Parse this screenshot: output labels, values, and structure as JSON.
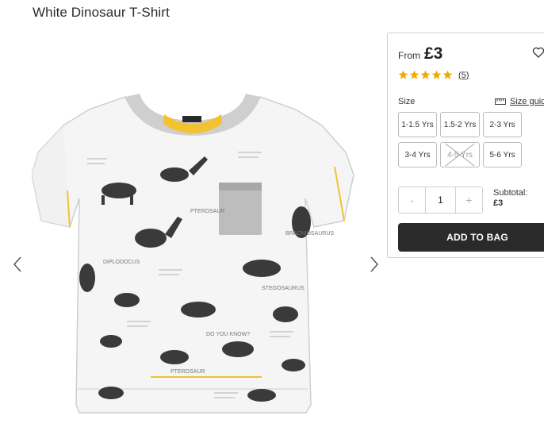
{
  "product": {
    "title": "White Dinosaur T-Shirt"
  },
  "gallery": {
    "prev_icon": "chevron-left-icon",
    "next_icon": "chevron-right-icon",
    "shirt_texts": [
      "PTEROSAUR",
      "DIPLODOCUS",
      "STEGOSAURUS",
      "BRACHIOSAURUS",
      "DO YOU KNOW?",
      "PTEROSAUR"
    ]
  },
  "panel": {
    "from_label": "From",
    "price": "£3",
    "wishlist_icon": "heart-icon",
    "rating": {
      "stars": 5,
      "max": 5,
      "count_label": "(5)"
    },
    "size_label": "Size",
    "size_guide_label": "Size guide",
    "size_guide_icon": "ruler-icon",
    "sizes": [
      {
        "label": "1-1.5 Yrs",
        "available": true
      },
      {
        "label": "1.5-2 Yrs",
        "available": true
      },
      {
        "label": "2-3 Yrs",
        "available": true
      },
      {
        "label": "3-4 Yrs",
        "available": true
      },
      {
        "label": "4-5 Yrs",
        "available": false
      },
      {
        "label": "5-6 Yrs",
        "available": true
      }
    ],
    "quantity": {
      "minus": "-",
      "value": "1",
      "plus": "+"
    },
    "subtotal_label": "Subtotal:",
    "subtotal_value": "£3",
    "add_to_bag": "ADD TO BAG"
  },
  "colors": {
    "button_bg": "#2a2a2a",
    "star": "#f0a900",
    "collar_accent": "#f2c230",
    "pocket": "#bdbdbd"
  }
}
